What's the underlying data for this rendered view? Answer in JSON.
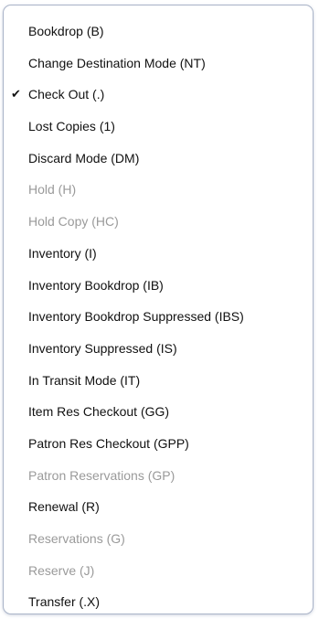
{
  "menu": {
    "items": [
      {
        "label": "Bookdrop (B)",
        "enabled": true,
        "checked": false
      },
      {
        "label": "Change Destination Mode (NT)",
        "enabled": true,
        "checked": false
      },
      {
        "label": "Check Out (.)",
        "enabled": true,
        "checked": true
      },
      {
        "label": "Lost Copies (1)",
        "enabled": true,
        "checked": false
      },
      {
        "label": "Discard Mode (DM)",
        "enabled": true,
        "checked": false
      },
      {
        "label": "Hold (H)",
        "enabled": false,
        "checked": false
      },
      {
        "label": "Hold Copy (HC)",
        "enabled": false,
        "checked": false
      },
      {
        "label": "Inventory (I)",
        "enabled": true,
        "checked": false
      },
      {
        "label": "Inventory Bookdrop (IB)",
        "enabled": true,
        "checked": false
      },
      {
        "label": "Inventory Bookdrop Suppressed (IBS)",
        "enabled": true,
        "checked": false
      },
      {
        "label": "Inventory Suppressed (IS)",
        "enabled": true,
        "checked": false
      },
      {
        "label": "In Transit Mode (IT)",
        "enabled": true,
        "checked": false
      },
      {
        "label": "Item Res Checkout (GG)",
        "enabled": true,
        "checked": false
      },
      {
        "label": "Patron Res Checkout (GPP)",
        "enabled": true,
        "checked": false
      },
      {
        "label": "Patron Reservations (GP)",
        "enabled": false,
        "checked": false
      },
      {
        "label": "Renewal (R)",
        "enabled": true,
        "checked": false
      },
      {
        "label": "Reservations (G)",
        "enabled": false,
        "checked": false
      },
      {
        "label": "Reserve (J)",
        "enabled": false,
        "checked": false
      },
      {
        "label": "Transfer (.X)",
        "enabled": true,
        "checked": false
      }
    ],
    "check_glyph": "✔"
  }
}
